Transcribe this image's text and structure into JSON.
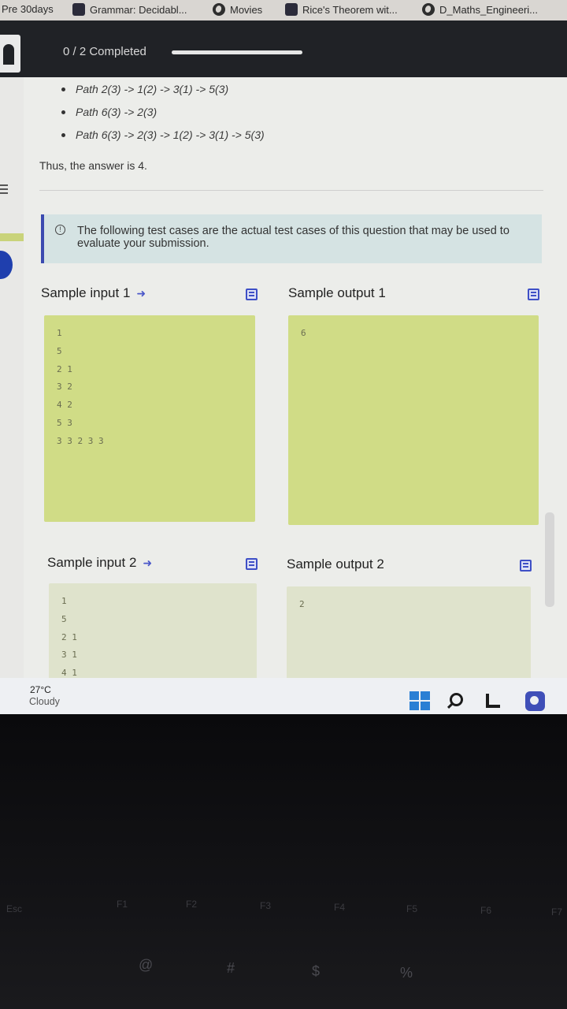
{
  "bookmarks": [
    {
      "label": "Pre 30days",
      "icon": "none"
    },
    {
      "label": "Grammar: Decidabl...",
      "icon": "bookmark-icon"
    },
    {
      "label": "Movies",
      "icon": "globe-icon"
    },
    {
      "label": "Rice's Theorem wit...",
      "icon": "bookmark-icon"
    },
    {
      "label": "D_Maths_Engineeri...",
      "icon": "globe-icon"
    }
  ],
  "header": {
    "progress_text": "0 / 2 Completed",
    "progress_fraction": 0.0
  },
  "explanation": {
    "paths": [
      "Path 2(3) -> 1(2) -> 3(1) -> 5(3)",
      "Path 6(3) -> 2(3)",
      "Path 6(3) -> 2(3) -> 1(2) -> 3(1) -> 5(3)"
    ],
    "answer_text": "Thus, the answer is 4."
  },
  "info_banner": {
    "text": "The following test cases are the actual test cases of this question that may be used to evaluate your submission."
  },
  "samples": [
    {
      "input_title": "Sample input 1",
      "output_title": "Sample output 1",
      "input_lines": [
        "1",
        "5",
        "2 1",
        "3 2",
        "4 2",
        "5 3",
        "3 3 2 3 3"
      ],
      "output_lines": [
        "6"
      ]
    },
    {
      "input_title": "Sample input 2",
      "output_title": "Sample output 2",
      "input_lines": [
        "1",
        "5",
        "2 1",
        "3 1",
        "4 1"
      ],
      "output_lines": [
        "2"
      ]
    }
  ],
  "taskbar": {
    "temperature": "27°C",
    "condition": "Cloudy"
  },
  "keyboard": {
    "keys": [
      "Esc",
      "F1",
      "F2",
      "F3",
      "F4",
      "F5",
      "F6",
      "F7",
      "@",
      "#",
      "$",
      "%"
    ]
  },
  "colors": {
    "accent": "#3e4fc6",
    "sample_box": "#d0dc86",
    "info_bg": "#d5e3e3"
  }
}
